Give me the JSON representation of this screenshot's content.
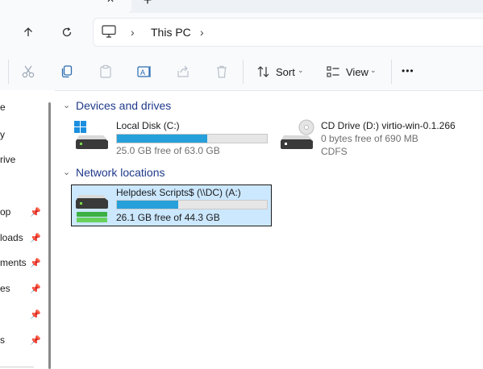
{
  "tabbar": {
    "close_icon": "close-icon",
    "new_tab_icon": "plus-icon"
  },
  "nav": {
    "up_icon": "arrow-up-icon",
    "refresh_icon": "refresh-icon",
    "computer_icon": "computer-icon",
    "breadcrumb": [
      "This PC"
    ]
  },
  "toolbar": {
    "cut_icon": "cut-icon",
    "copy_icon": "copy-icon",
    "paste_icon": "paste-icon",
    "rename_icon": "rename-icon",
    "share_icon": "share-icon",
    "delete_icon": "delete-icon",
    "sort_label": "Sort",
    "view_label": "View",
    "more_label": "•••"
  },
  "sidebar": {
    "items": [
      {
        "label": "e"
      },
      {
        "label": "y"
      },
      {
        "label": "rive"
      },
      {
        "label": "op",
        "pinned": true
      },
      {
        "label": "loads",
        "pinned": true
      },
      {
        "label": "ments",
        "pinned": true
      },
      {
        "label": "es",
        "pinned": true
      },
      {
        "label": "",
        "pinned": true
      },
      {
        "label": "s",
        "pinned": true
      }
    ]
  },
  "groups": {
    "devices": {
      "title": "Devices and drives",
      "drives": [
        {
          "name": "Local Disk (C:)",
          "free": "25.0 GB free of 63.0 GB",
          "used_fraction": 0.603
        },
        {
          "name": "CD Drive (D:) virtio-win-0.1.266",
          "free": "0 bytes free of 690 MB",
          "fs": "CDFS"
        }
      ]
    },
    "network": {
      "title": "Network locations",
      "drives": [
        {
          "name": "Helpdesk Scripts$ (\\\\DC) (A:)",
          "free": "26.1 GB free of 44.3 GB",
          "used_fraction": 0.411
        }
      ]
    }
  },
  "colors": {
    "accent": "#26a0da",
    "header": "#1f3a8a",
    "selection": "#cce8ff"
  }
}
